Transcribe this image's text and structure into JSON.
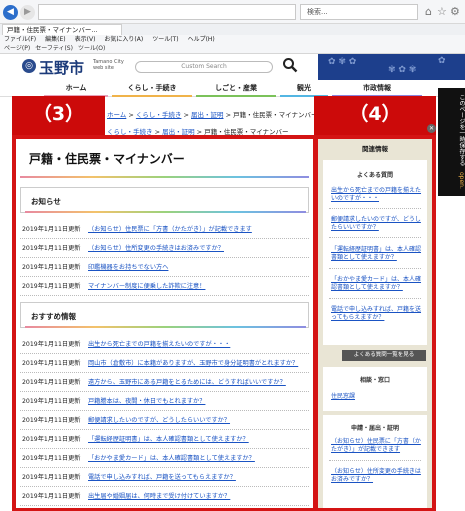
{
  "browser": {
    "address": "",
    "search_placeholder": "検索...",
    "tab_title": "戸籍・住民票・マイナンバー...",
    "menu": [
      "ファイル(F)",
      "編集(E)",
      "表示(V)",
      "お気に入り(A)",
      "ツール(T)",
      "ヘルプ(H)"
    ],
    "favbar": [
      "ページ(P)",
      "セーフティ(S)",
      "ツール(O)"
    ]
  },
  "site": {
    "logo": "玉野市",
    "logo_sub": "Tamano City web site",
    "search_placeholder": "Custom Search",
    "nav": [
      {
        "label": "ホーム",
        "color": "#e8a0b8"
      },
      {
        "label": "くらし・手続き",
        "color": "#f0b34a"
      },
      {
        "label": "しごと・産業",
        "color": "#7bc25a"
      },
      {
        "label": "観光",
        "color": "#53b6e3"
      },
      {
        "label": "市政情報",
        "color": "#8b82dc"
      }
    ]
  },
  "breadcrumb1": {
    "links": [
      "ホーム",
      "くらし・手続き",
      "届出・証明"
    ],
    "current": "戸籍・住民票・マイナンバー"
  },
  "breadcrumb2": {
    "links": [
      "くらし・手続き",
      "届出・証明"
    ],
    "current": "戸籍・住民票・マイナンバー"
  },
  "annotations": {
    "left": "（3）",
    "right": "（4）"
  },
  "main": {
    "title": "戸籍・住民票・マイナンバー",
    "news_heading": "お知らせ",
    "news": [
      {
        "date": "2019年1月11日更新",
        "text": "（お知らせ）住民票に「方書（かたがき）」が記載できます"
      },
      {
        "date": "2019年1月11日更新",
        "text": "（お知らせ）住所変更の手続きはお済みですか？"
      },
      {
        "date": "2019年1月11日更新",
        "text": "印鑑機器をお持ちでない方へ"
      },
      {
        "date": "2019年1月11日更新",
        "text": "マイナンバー制度に便乗した詐欺に注意！"
      }
    ],
    "recommend_heading": "おすすめ情報",
    "recommend": [
      {
        "date": "2019年1月11日更新",
        "text": "出生から死亡までの戸籍を揃えたいのですが・・・"
      },
      {
        "date": "2019年1月11日更新",
        "text": "岡山市（倉敷市）に本籍がありますが、玉野市で身分証明書がとれますか？"
      },
      {
        "date": "2019年1月11日更新",
        "text": "遠方から、玉野市にある戸籍をとるためには、どうすればいいですか？"
      },
      {
        "date": "2019年1月11日更新",
        "text": "戸籍謄本は、夜間・休日でもとれますか？"
      },
      {
        "date": "2019年1月11日更新",
        "text": "郵便請求したいのですが、どうしたらいいですか？"
      },
      {
        "date": "2019年1月11日更新",
        "text": "「運転経歴証明書」は、本人確認書類として使えますか？"
      },
      {
        "date": "2019年1月11日更新",
        "text": "「おかやま愛カード」は、本人確認書類として使えますか？"
      },
      {
        "date": "2019年1月11日更新",
        "text": "電話で申し込みすれば、戸籍を送ってもらえますか？"
      },
      {
        "date": "2019年1月11日更新",
        "text": "出生届や婚姻届は、何時まで受け付けていますか？"
      }
    ]
  },
  "sidebar": {
    "heading": "関連情報",
    "faq_heading": "よくある質問",
    "faq": [
      "出生から死亡までの戸籍を揃えたいのですが・・・",
      "郵便請求したいのですが、どうしたらいいですか？",
      "「運転経歴証明書」は、本人確認書類として使えますか？",
      "「おかやま愛カード」は、本人確認書類として使えますか？",
      "電話で申し込みすれば、戸籍を送ってもらえますか？"
    ],
    "more_button": "よくある質問一覧を見る",
    "counter_heading": "相談・窓口",
    "counter_link": "住民窓課",
    "cert_heading": "申請・届出・証明",
    "cert_links": [
      "（お知らせ）住民票に「方書（かたがき）」が記載できます",
      "（お知らせ）住所変更の手続きはお済みですか？"
    ]
  },
  "save_banner": {
    "text": "このページを一時保存する",
    "sub": "open."
  }
}
